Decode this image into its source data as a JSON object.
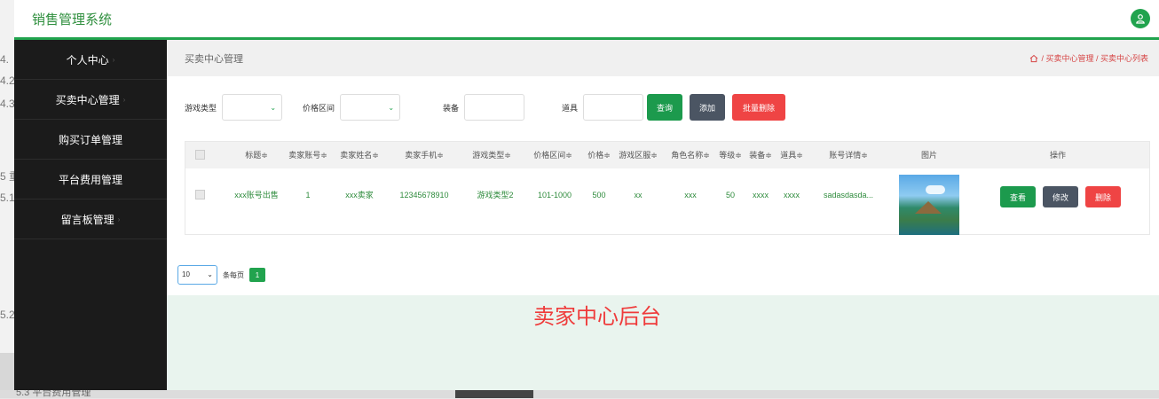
{
  "background": {
    "left_digits": [
      "4.",
      "4.2",
      "4.3",
      "5 重",
      "5.1",
      "5.2"
    ],
    "bottom_text": "5.3 平台费用管理"
  },
  "header": {
    "title": "销售管理系统",
    "user_icon": "user-icon"
  },
  "sidebar": {
    "items": [
      {
        "label": "个人中心"
      },
      {
        "label": "买卖中心管理"
      },
      {
        "label": "购买订单管理"
      },
      {
        "label": "平台费用管理"
      },
      {
        "label": "留言板管理"
      }
    ]
  },
  "breadcrumb": {
    "title": "买卖中心管理",
    "path": "/ 买卖中心管理 / 买卖中心列表"
  },
  "search": {
    "game_type_label": "游戏类型",
    "price_range_label": "价格区间",
    "equipment_label": "装备",
    "props_label": "道具",
    "query_button": "查询",
    "add_button": "添加",
    "batch_delete_button": "批量删除"
  },
  "table": {
    "columns": [
      "标题≑",
      "卖家账号≑",
      "卖家姓名≑",
      "卖家手机≑",
      "游戏类型≑",
      "价格区间≑",
      "价格≑",
      "游戏区服≑",
      "角色名称≑",
      "等级≑",
      "装备≑",
      "道具≑",
      "账号详情≑",
      "图片",
      "操作"
    ],
    "rows": [
      {
        "title": "xxx账号出售",
        "seller_account": "1",
        "seller_name": "xxx卖家",
        "seller_phone": "12345678910",
        "game_type": "游戏类型2",
        "price_range": "101-1000",
        "price": "500",
        "server": "xx",
        "role_name": "xxx",
        "level": "50",
        "equipment": "xxxx",
        "props": "xxxx",
        "account_detail": "sadasdasda...",
        "actions": {
          "view": "查看",
          "edit": "修改",
          "delete": "删除"
        }
      }
    ]
  },
  "pager": {
    "page_size": "10",
    "per_page_label": "条每页",
    "current_page": "1"
  },
  "footer": {
    "title": "卖家中心后台"
  },
  "colors": {
    "accent": "#21a34e",
    "danger": "#ef4444",
    "sidebar": "#1b1b1b"
  }
}
